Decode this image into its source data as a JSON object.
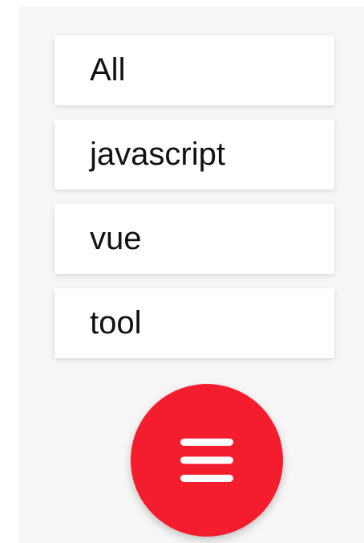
{
  "menu": {
    "items": [
      {
        "label": "All"
      },
      {
        "label": "javascript"
      },
      {
        "label": "vue"
      },
      {
        "label": "tool"
      }
    ]
  },
  "fab": {
    "icon": "menu-icon",
    "color": "#f41d2e"
  }
}
